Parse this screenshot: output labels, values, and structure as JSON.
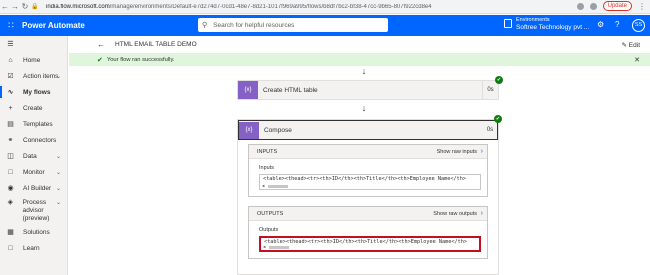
{
  "browser": {
    "url_host": "india.flow.microsoft.com",
    "url_path": "/manage/environments/Default-e7d274d7-0cd1-48e7-8d21-1017f969a995/flows/b8df7bc2-bf38-47cc-9b65-807f922cd8e4",
    "update_label": "Update"
  },
  "header": {
    "app_name": "Power Automate",
    "search_placeholder": "Search for helpful resources",
    "env_label": "Environments",
    "env_name": "Softree Technology pvt ...",
    "avatar_initials": "SS"
  },
  "sidebar": {
    "items": [
      {
        "label": "Home",
        "icon": "home-icon"
      },
      {
        "label": "Action items",
        "icon": "checklist-icon"
      },
      {
        "label": "My flows",
        "icon": "flow-icon"
      },
      {
        "label": "Create",
        "icon": "plus-icon"
      },
      {
        "label": "Templates",
        "icon": "templates-icon"
      },
      {
        "label": "Connectors",
        "icon": "connector-icon"
      },
      {
        "label": "Data",
        "icon": "data-icon"
      },
      {
        "label": "Monitor",
        "icon": "monitor-icon"
      },
      {
        "label": "AI Builder",
        "icon": "ai-icon"
      },
      {
        "label": "Process advisor",
        "label2": "(preview)",
        "icon": "process-icon"
      },
      {
        "label": "Solutions",
        "icon": "solutions-icon"
      },
      {
        "label": "Learn",
        "icon": "learn-icon"
      }
    ]
  },
  "command_bar": {
    "flow_name": "HTML EMAIL TABLE DEMO",
    "edit_label": "Edit"
  },
  "banner": {
    "message": "Your flow ran successfully."
  },
  "actions": {
    "create_html": {
      "title": "Create HTML table",
      "duration": "0s",
      "icon_text": "{x}"
    },
    "compose": {
      "title": "Compose",
      "duration": "0s",
      "icon_text": "{x}"
    }
  },
  "inputs_panel": {
    "header": "INPUTS",
    "show_raw": "Show raw inputs",
    "field_label": "Inputs",
    "value": "<table><thead><tr><th>ID</th><th>Title</th><th>Employee Name</th>"
  },
  "outputs_panel": {
    "header": "OUTPUTS",
    "show_raw": "Show raw outputs",
    "field_label": "Outputs",
    "value": "<table><thead><tr><th>ID</th><th>Title</th><th>Employee Name</th>"
  },
  "colors": {
    "brand": "#0066ff",
    "success": "#107c10",
    "highlight": "#c50f1f",
    "action_icon": "#8661c5"
  }
}
